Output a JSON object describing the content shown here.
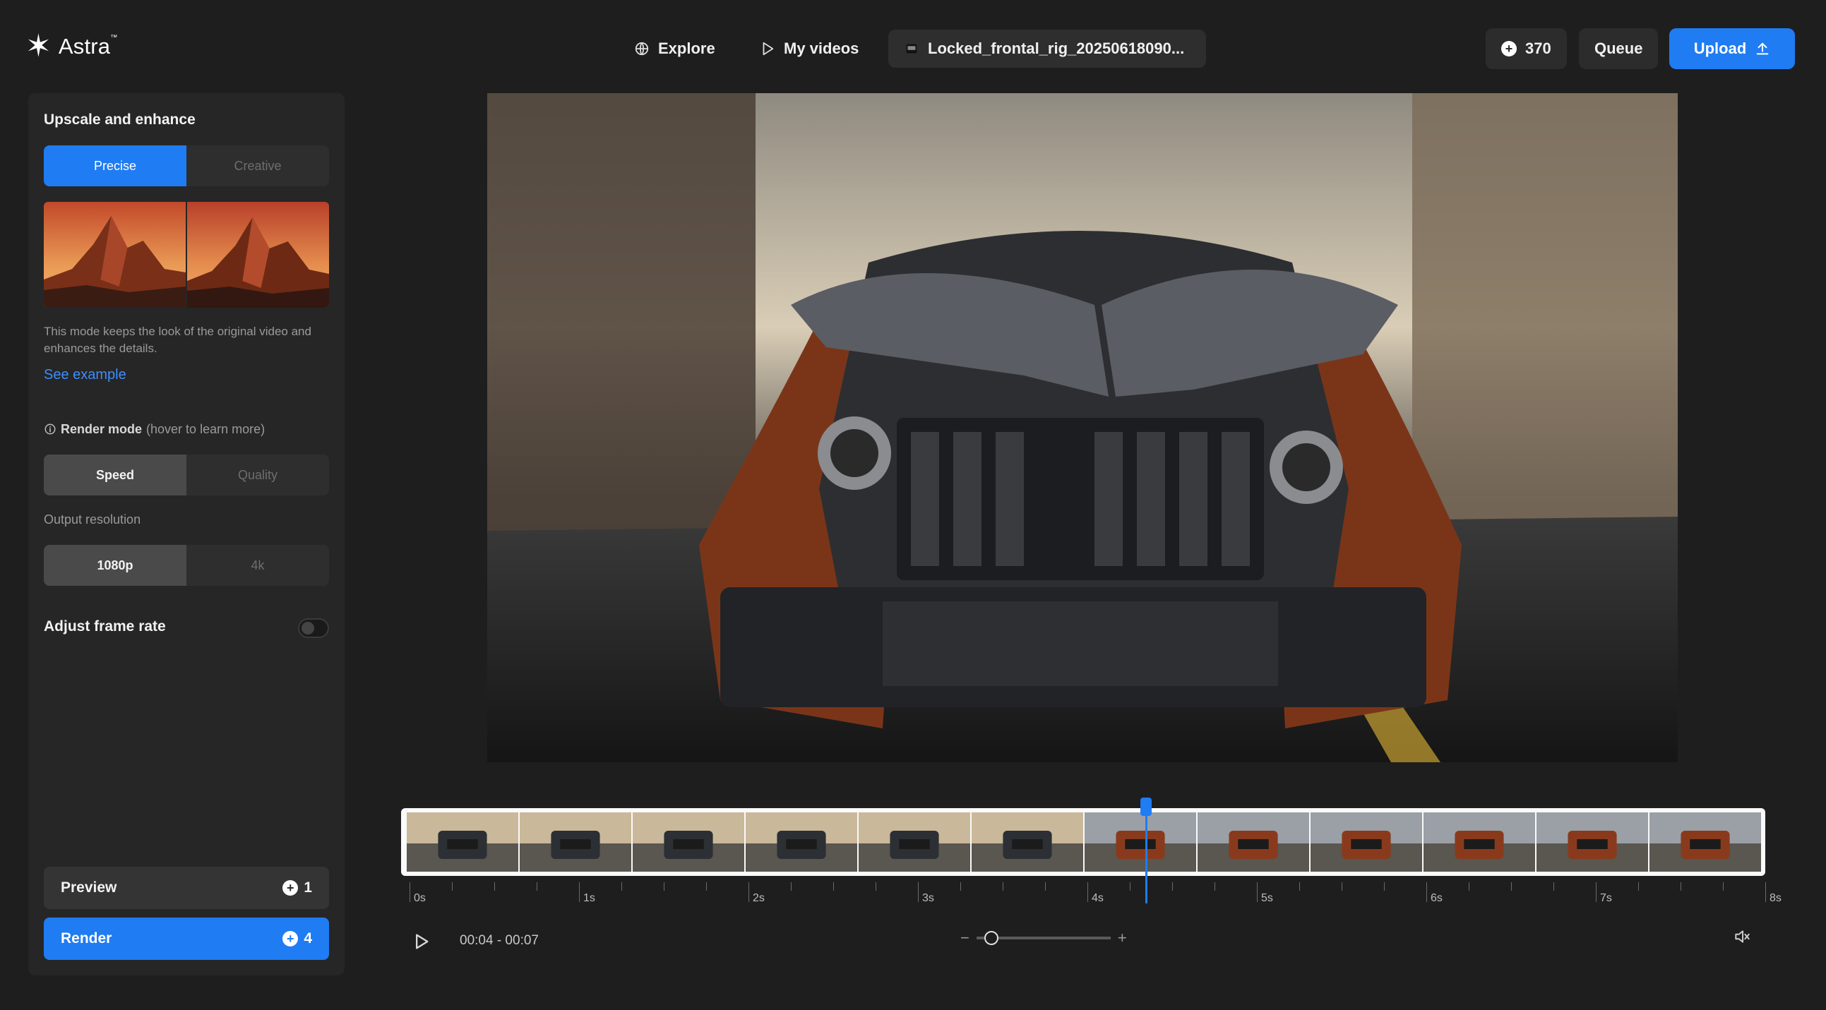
{
  "app": {
    "name": "Astra",
    "trademark": "™"
  },
  "nav": {
    "explore": "Explore",
    "my_videos": "My videos",
    "file_tab": "Locked_frontal_rig_20250618090..."
  },
  "topright": {
    "credits": "370",
    "queue": "Queue",
    "upload": "Upload"
  },
  "sidebar": {
    "section_title": "Upscale and enhance",
    "mode_options": [
      "Precise",
      "Creative"
    ],
    "mode_selected": "Precise",
    "mode_description": "This mode keeps the look of the original video and enhances the details.",
    "see_example": "See example",
    "render_mode_label": "Render mode",
    "render_mode_hint": "(hover to learn more)",
    "render_options": [
      "Speed",
      "Quality"
    ],
    "render_selected": "Speed",
    "resolution_label": "Output resolution",
    "resolution_options": [
      "1080p",
      "4k"
    ],
    "resolution_selected": "1080p",
    "frame_rate_label": "Adjust frame rate",
    "frame_rate_enabled": false,
    "preview_label": "Preview",
    "preview_cost": "1",
    "render_label": "Render",
    "render_cost": "4"
  },
  "timeline": {
    "tick_labels": [
      "0s",
      "1s",
      "2s",
      "3s",
      "4s",
      "5s",
      "6s",
      "7s",
      "8s"
    ],
    "playhead_time": "4.4s",
    "time_range": "00:04 - 00:07",
    "zoom_minus": "−",
    "zoom_plus": "+",
    "zoom_level": 0.1
  },
  "colors": {
    "accent": "#1f7cf2",
    "background": "#1e1e1e",
    "panel": "#262626"
  }
}
